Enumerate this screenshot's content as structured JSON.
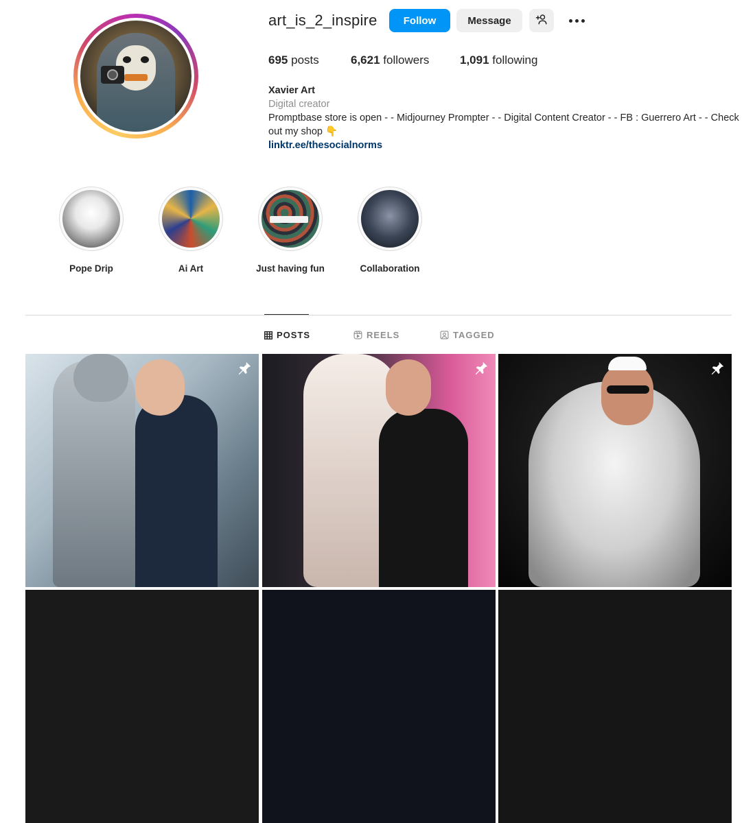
{
  "profile": {
    "username": "art_is_2_inspire",
    "follow_label": "Follow",
    "message_label": "Message",
    "stats": {
      "posts_count": "695",
      "posts_label": "posts",
      "followers_count": "6,621",
      "followers_label": "followers",
      "following_count": "1,091",
      "following_label": "following"
    },
    "bio": {
      "name": "Xavier Art",
      "category": "Digital creator",
      "text": "Promptbase store is open - - Midjourney Prompter - - Digital Content Creator - - FB : Guerrero Art - - Check out my shop 👇",
      "link": "linktr.ee/thesocialnorms"
    }
  },
  "highlights": [
    {
      "label": "Pope Drip"
    },
    {
      "label": "Ai Art"
    },
    {
      "label": "Just having fun"
    },
    {
      "label": "Collaboration"
    }
  ],
  "tabs": {
    "posts": "POSTS",
    "reels": "REELS",
    "tagged": "TAGGED"
  },
  "icons": {
    "add_user": "add-user-icon",
    "more": "more-options-icon",
    "grid": "grid-icon",
    "reels": "reels-icon",
    "tagged": "tagged-icon",
    "pin": "pinned-icon"
  },
  "colors": {
    "follow_button": "#0095f6",
    "secondary_button": "#efefef",
    "link": "#00376b",
    "muted": "#8e8e8e"
  }
}
